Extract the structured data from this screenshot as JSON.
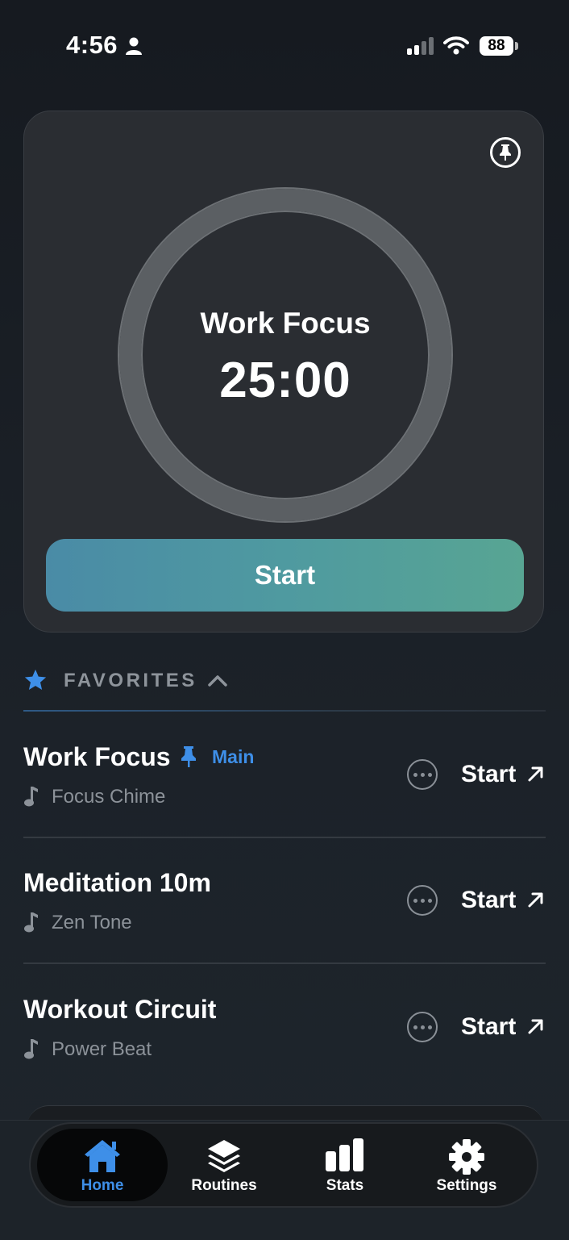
{
  "status_bar": {
    "time": "4:56",
    "battery": "88"
  },
  "timer_card": {
    "routine_name": "Work Focus",
    "time_remaining": "25:00",
    "start_label": "Start"
  },
  "favorites": {
    "header": "FAVORITES",
    "items": [
      {
        "title": "Work Focus",
        "badge": "Main",
        "sound": "Focus Chime",
        "start_label": "Start",
        "pinned": true
      },
      {
        "title": "Meditation 10m",
        "sound": "Zen Tone",
        "start_label": "Start",
        "pinned": false
      },
      {
        "title": "Workout Circuit",
        "sound": "Power Beat",
        "start_label": "Start",
        "pinned": false
      }
    ]
  },
  "tabs": [
    {
      "label": "Home",
      "icon": "house-icon",
      "active": true
    },
    {
      "label": "Routines",
      "icon": "layers-icon",
      "active": false
    },
    {
      "label": "Stats",
      "icon": "bar-chart-icon",
      "active": false
    },
    {
      "label": "Settings",
      "icon": "gear-icon",
      "active": false
    }
  ],
  "colors": {
    "accent": "#3e8fe8",
    "start_gradient_from": "#4a8ba6",
    "start_gradient_to": "#58a593",
    "background": "#1a1f25"
  }
}
